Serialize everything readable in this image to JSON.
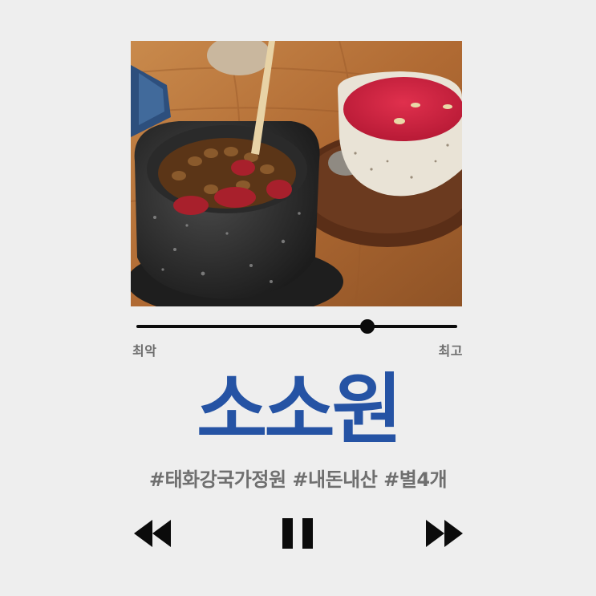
{
  "player": {
    "title": "소소원",
    "tags": "#태화강국가정원 #내돈내산 #별4개",
    "rating_scale": {
      "min_label": "최악",
      "max_label": "최고",
      "position_fraction": 0.72
    },
    "controls": {
      "rewind_icon": "rewind-icon",
      "pause_icon": "pause-icon",
      "forward_icon": "fast-forward-icon"
    }
  },
  "colors": {
    "background": "#eeeeee",
    "title": "#2553a4",
    "tags": "#6f6f6f",
    "scale_labels": "#6d6d6d",
    "controls": "#0b0b0b"
  }
}
